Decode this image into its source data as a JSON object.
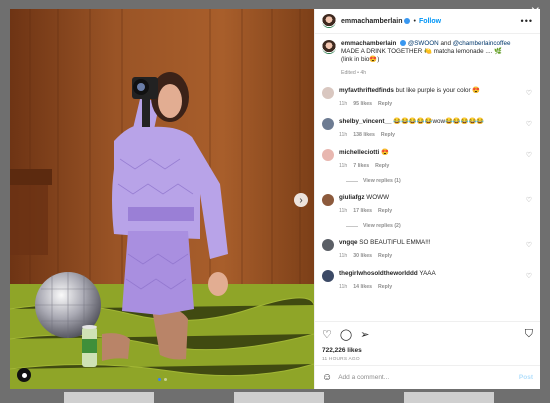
{
  "window": {
    "close_glyph": "×"
  },
  "post": {
    "username": "emmachamberlain",
    "follow_label": "Follow",
    "separator": "•",
    "more_glyph": "•••",
    "caption": {
      "username": "emmachamberlain",
      "line1_pre": " ",
      "mention1": "@SWOON",
      "and": " and ",
      "mention2": "@chamberlaincoffee",
      "line2": "MADE A DRINK TOGETHER 🍋 matcha lemonade .... 🌿",
      "line3": "(link in bio😍)",
      "meta": "Edited • 4h"
    },
    "comments": [
      {
        "username": "myfavthriftedfinds",
        "text": " but like purple is your color 😍",
        "age": "11h",
        "likes": "95 likes",
        "reply": "Reply",
        "avatar_color": "#d9c7c0",
        "replies": ""
      },
      {
        "username": "shelby_vincent__",
        "text": " 😂😂😂😂😂wow😂😂😂😂😂",
        "age": "11h",
        "likes": "138 likes",
        "reply": "Reply",
        "avatar_color": "#6d7b92",
        "replies": ""
      },
      {
        "username": "michelleciotti",
        "text": " 😍",
        "age": "11h",
        "likes": "7 likes",
        "reply": "Reply",
        "avatar_color": "#e8b7b0",
        "replies": "View replies (1)"
      },
      {
        "username": "giuliafgz",
        "text": " WOWW",
        "age": "11h",
        "likes": "17 likes",
        "reply": "Reply",
        "avatar_color": "#8c5a3c",
        "replies": "View replies (2)"
      },
      {
        "username": "vngqe",
        "text": " SO BEAUTIFUL EMMA!!!",
        "age": "11h",
        "likes": "30 likes",
        "reply": "Reply",
        "avatar_color": "#5b5f66",
        "replies": ""
      },
      {
        "username": "thegirlwhosoldtheworlddd",
        "text": " YAAA",
        "age": "11h",
        "likes": "14 likes",
        "reply": "Reply",
        "avatar_color": "#3c4a66",
        "replies": ""
      }
    ],
    "actions": {
      "like_icon": "heart-icon",
      "comment_icon": "comment-icon",
      "share_icon": "share-icon",
      "save_icon": "bookmark-icon"
    },
    "likes": "722,226 likes",
    "time_ago": "11 HOURS AGO",
    "add_comment": {
      "placeholder": "Add a comment...",
      "post_label": "Post"
    }
  },
  "colors": {
    "link": "#0095f6",
    "mention": "#00376b",
    "muted": "#8e8e8e"
  }
}
